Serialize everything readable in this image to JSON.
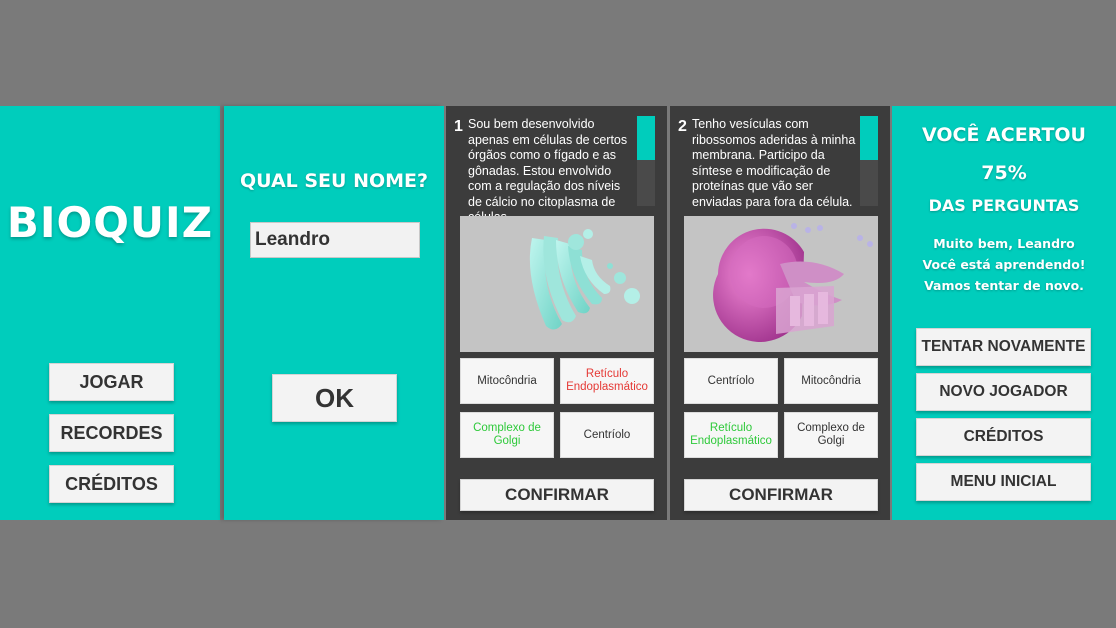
{
  "menu": {
    "title": "BIOQUIZ",
    "buttons": [
      "JOGAR",
      "RECORDES",
      "CRÉDITOS"
    ]
  },
  "name_screen": {
    "question": "QUAL SEU NOME?",
    "name_value": "Leandro",
    "ok_label": "OK"
  },
  "question1": {
    "number": "1",
    "text": "Sou bem desenvolvido apenas em células de certos órgãos como o fígado e as gônadas. Estou envolvido com a regulação dos níveis de cálcio no citoplasma de células",
    "options": [
      "Mitocôndria",
      "Retículo Endoplasmático",
      "Complexo de Golgi",
      "Centríolo"
    ],
    "option_colors": [
      "#333333",
      "#e53935",
      "#2ec93a",
      "#333333"
    ],
    "confirm_label": "CONFIRMAR",
    "image_icon": "golgi-apparatus-illustration"
  },
  "question2": {
    "number": "2",
    "text": "Tenho vesículas com ribossomos aderidas à minha membrana. Participo da síntese e modificação de proteínas que vão ser enviadas para fora da célula.",
    "options": [
      "Centríolo",
      "Mitocôndria",
      "Retículo Endoplasmático",
      "Complexo de Golgi"
    ],
    "option_colors": [
      "#333333",
      "#333333",
      "#2ec93a",
      "#333333"
    ],
    "confirm_label": "CONFIRMAR",
    "image_icon": "endoplasmic-reticulum-illustration"
  },
  "result": {
    "line1": "VOCÊ ACERTOU",
    "percent": "75%",
    "line3": "DAS PERGUNTAS",
    "message1": "Muito bem, Leandro",
    "message2": "Você está aprendendo!",
    "message3": "Vamos tentar de novo.",
    "buttons": [
      "TENTAR NOVAMENTE",
      "NOVO JOGADOR",
      "CRÉDITOS",
      "MENU INICIAL"
    ]
  },
  "colors": {
    "teal": "#00cdbc",
    "dark": "#3c3c3c",
    "background": "#7a7a7a",
    "correct": "#2ec93a",
    "wrong": "#e53935"
  }
}
